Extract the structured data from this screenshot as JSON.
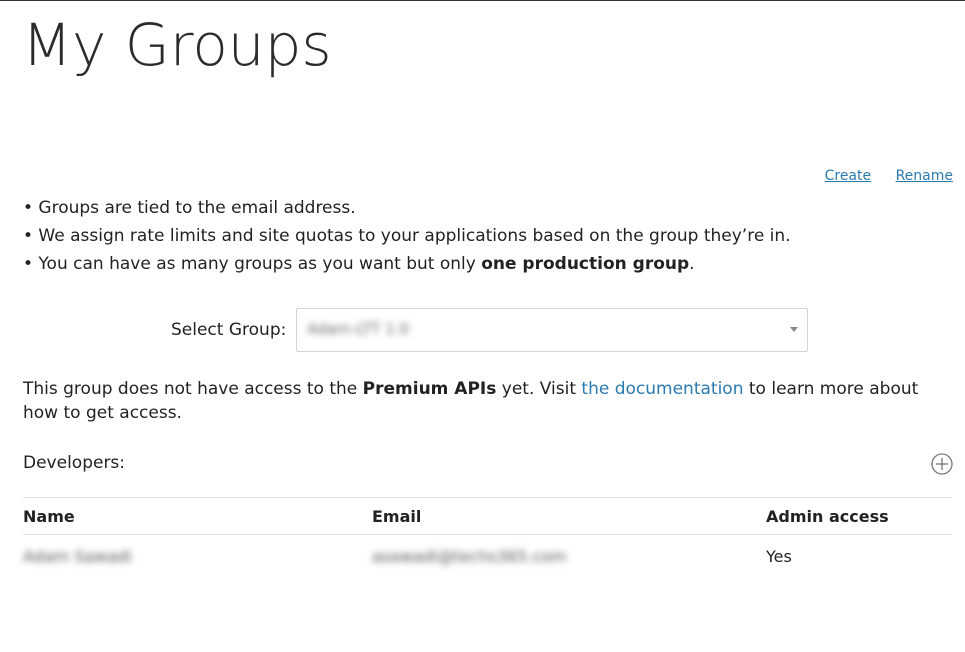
{
  "page": {
    "title": "My Groups"
  },
  "actions": {
    "create_label": "Create",
    "rename_label": "Rename"
  },
  "bullets": [
    "• Groups are tied to the email address.",
    "• We assign rate limits and site quotas to your applications based on the group they’re in.",
    {
      "pre": "• You can have as many groups as you want but only ",
      "bold": "one production group",
      "post": "."
    }
  ],
  "select_group": {
    "label": "Select Group:",
    "value": "Adam-LTT 1.0"
  },
  "notice": {
    "pre": "This group does not have access to the ",
    "bold": "Premium APIs",
    "mid": " yet. Visit ",
    "link": "the documentation",
    "post": " to learn more about how to get access."
  },
  "developers": {
    "label": "Developers:",
    "columns": [
      "Name",
      "Email",
      "Admin access"
    ],
    "rows": [
      {
        "name": "Adam Sawadi",
        "email": "asawadi@techs365.com",
        "admin": "Yes"
      }
    ]
  },
  "icons": {
    "add": "plus-circle-icon",
    "dropdown": "caret-down-icon"
  },
  "colors": {
    "link": "#2a7ab0",
    "text": "#222222",
    "divider": "#e4e4e4"
  }
}
